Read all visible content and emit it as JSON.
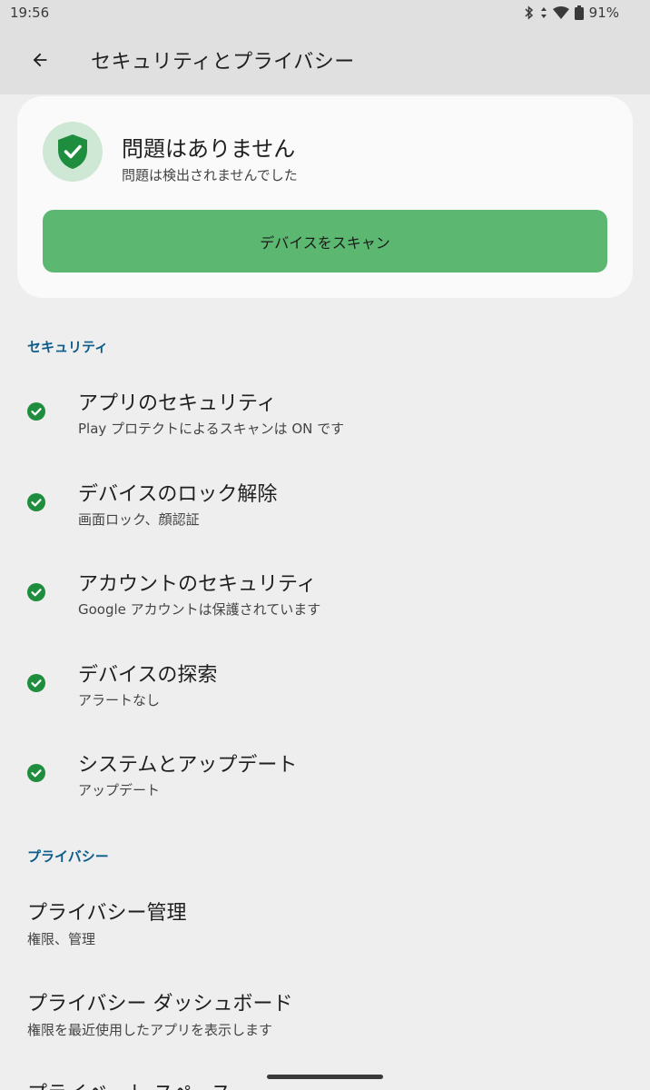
{
  "status_bar": {
    "time": "19:56",
    "battery": "91%"
  },
  "app_bar": {
    "title": "セキュリティとプライバシー"
  },
  "status_card": {
    "title": "問題はありません",
    "subtitle": "問題は検出されませんでした",
    "scan_button": "デバイスをスキャン"
  },
  "security": {
    "header": "セキュリティ",
    "items": [
      {
        "title": "アプリのセキュリティ",
        "subtitle": "Play プロテクトによるスキャンは ON です"
      },
      {
        "title": "デバイスのロック解除",
        "subtitle": "画面ロック、顔認証"
      },
      {
        "title": "アカウントのセキュリティ",
        "subtitle": "Google アカウントは保護されています"
      },
      {
        "title": "デバイスの探索",
        "subtitle": "アラートなし"
      },
      {
        "title": "システムとアップデート",
        "subtitle": "アップデート"
      }
    ]
  },
  "privacy": {
    "header": "プライバシー",
    "items": [
      {
        "title": "プライバシー管理",
        "subtitle": "権限、管理"
      },
      {
        "title": "プライバシー ダッシュボード",
        "subtitle": "権限を最近使用したアプリを表示します"
      },
      {
        "title": "プライベート スペース"
      }
    ]
  },
  "colors": {
    "accent_green": "#5cb870",
    "shield_green": "#1e8e3e",
    "section_blue": "#0b5c8a"
  }
}
